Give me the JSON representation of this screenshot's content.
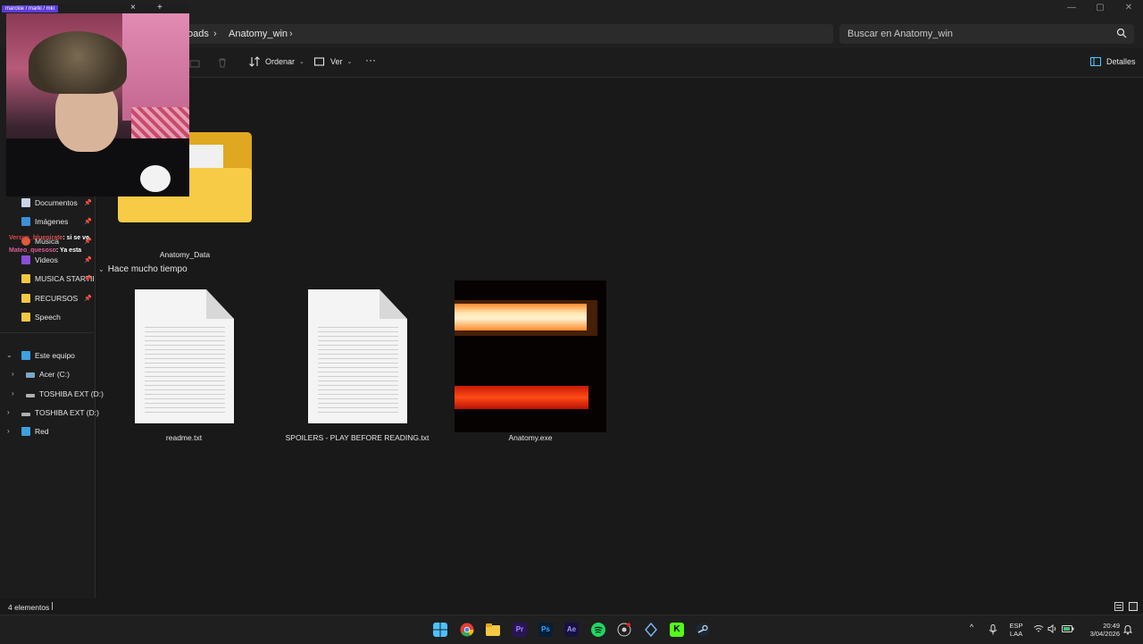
{
  "window": {
    "breadcrumb_partial": "oads",
    "breadcrumb_current": "Anatomy_win",
    "search_placeholder": "Buscar en Anatomy_win",
    "controls": [
      "—",
      "▢",
      "✕"
    ]
  },
  "stream_tab": {
    "label": "marckie / marki / mki"
  },
  "toolbar": {
    "sort_label": "Ordenar",
    "view_label": "Ver",
    "more_label": "···",
    "details_label": "Detalles"
  },
  "sidebar": {
    "pinned": [
      {
        "label": "Documentos",
        "icon": "document-icon"
      },
      {
        "label": "Imágenes",
        "icon": "images-icon"
      },
      {
        "label": "Música",
        "icon": "music-icon"
      },
      {
        "label": "Videos",
        "icon": "videos-icon"
      },
      {
        "label": "MUSICA STARTII",
        "icon": "folder-icon"
      },
      {
        "label": "RECURSOS",
        "icon": "folder-icon"
      },
      {
        "label": "Speech",
        "icon": "folder-icon"
      }
    ],
    "this_pc": "Este equipo",
    "drives": [
      {
        "label": "Acer (C:)",
        "icon": "drive-c-icon"
      },
      {
        "label": "TOSHIBA EXT (D:)",
        "icon": "drive-icon"
      }
    ],
    "external": {
      "label": "TOSHIBA EXT (D:)",
      "icon": "drive-icon"
    },
    "network": {
      "label": "Red",
      "icon": "network-icon"
    }
  },
  "chat": [
    {
      "user": "Versus_bluepirate",
      "message": ": si se ve"
    },
    {
      "user": "Mateo_quesoso",
      "message": ": Ya esta"
    }
  ],
  "files": {
    "folder": {
      "name": "Anatomy_Data"
    },
    "group_label": "Hace mucho tiempo",
    "items": [
      {
        "name": "readme.txt",
        "type": "text"
      },
      {
        "name": "SPOILERS - PLAY BEFORE READING.txt",
        "type": "text"
      },
      {
        "name": "Anatomy.exe",
        "type": "exe"
      }
    ]
  },
  "status": {
    "item_count": "4 elementos"
  },
  "taskbar": {
    "lang_top": "ESP",
    "lang_bottom": "LAA",
    "time": "20:49",
    "date": "3/04/2026",
    "apps": [
      "windows-start-icon",
      "chrome-icon",
      "file-explorer-icon",
      "premiere-icon",
      "photoshop-icon",
      "after-effects-icon",
      "spotify-icon",
      "obs-icon",
      "dev-icon",
      "kick-icon",
      "steam-icon"
    ]
  },
  "colors": {
    "background": "#191919",
    "panel": "#202020",
    "folder_yellow": "#f5c842",
    "accent_blue": "#4cc2ff",
    "stream_purple": "#5d3cdb"
  }
}
